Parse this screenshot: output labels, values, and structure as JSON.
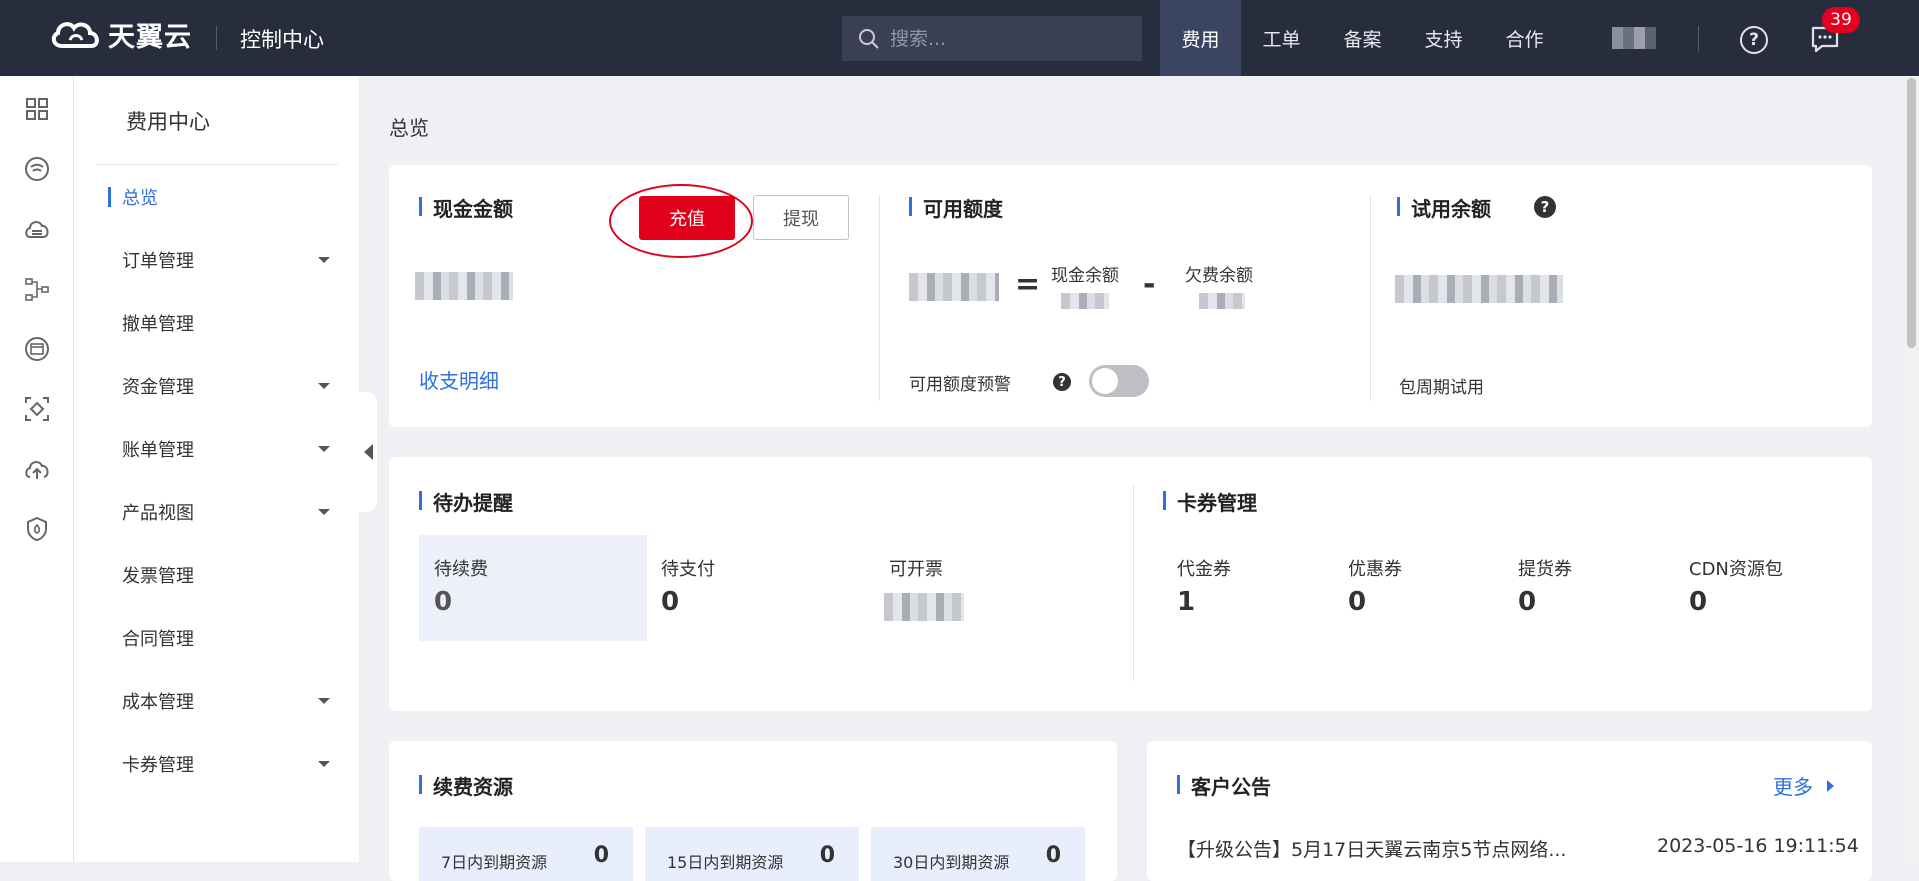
{
  "header": {
    "logo_text": "天翼云",
    "console_title": "控制中心",
    "search_placeholder": "搜索...",
    "nav": [
      "费用",
      "工单",
      "备案",
      "支持",
      "合作"
    ],
    "active_nav_index": 0,
    "help_icon": "question-circle-icon",
    "message_badge": "39"
  },
  "sidebar": {
    "title": "费用中心",
    "items": [
      {
        "label": "总览",
        "active": true,
        "expandable": false
      },
      {
        "label": "订单管理",
        "expandable": true
      },
      {
        "label": "撤单管理",
        "expandable": false
      },
      {
        "label": "资金管理",
        "expandable": true
      },
      {
        "label": "账单管理",
        "expandable": true
      },
      {
        "label": "产品视图",
        "expandable": true
      },
      {
        "label": "发票管理",
        "expandable": false
      },
      {
        "label": "合同管理",
        "expandable": false
      },
      {
        "label": "成本管理",
        "expandable": true
      },
      {
        "label": "卡券管理",
        "expandable": true
      }
    ]
  },
  "page": {
    "breadcrumb": "总览"
  },
  "balance": {
    "cash_title": "现金金额",
    "recharge_label": "充值",
    "withdraw_label": "提现",
    "detail_link": "收支明细",
    "credit_title": "可用额度",
    "eq": "=",
    "minus": "-",
    "cash_balance_label": "现金余额",
    "owed_balance_label": "欠费余额",
    "alert_label": "可用额度预警",
    "alert_enabled": false,
    "trial_title": "试用余额",
    "trial_sub": "包周期试用",
    "question_mark": "?"
  },
  "todo": {
    "title": "待办提醒",
    "items": [
      {
        "label": "待续费",
        "value": "0"
      },
      {
        "label": "待支付",
        "value": "0"
      },
      {
        "label": "可开票",
        "value": ""
      }
    ]
  },
  "coupons": {
    "title": "卡券管理",
    "items": [
      {
        "label": "代金券",
        "value": "1"
      },
      {
        "label": "优惠券",
        "value": "0"
      },
      {
        "label": "提货券",
        "value": "0"
      },
      {
        "label": "CDN资源包",
        "value": "0"
      }
    ]
  },
  "renewal": {
    "title": "续费资源",
    "items": [
      {
        "label": "7日内到期资源",
        "value": "0"
      },
      {
        "label": "15日内到期资源",
        "value": "0"
      },
      {
        "label": "30日内到期资源",
        "value": "0"
      }
    ]
  },
  "announcements": {
    "title": "客户公告",
    "more_label": "更多",
    "items": [
      {
        "text": "【升级公告】5月17日天翼云南京5节点网络...",
        "date": "2023-05-16 19:11:54"
      }
    ]
  }
}
